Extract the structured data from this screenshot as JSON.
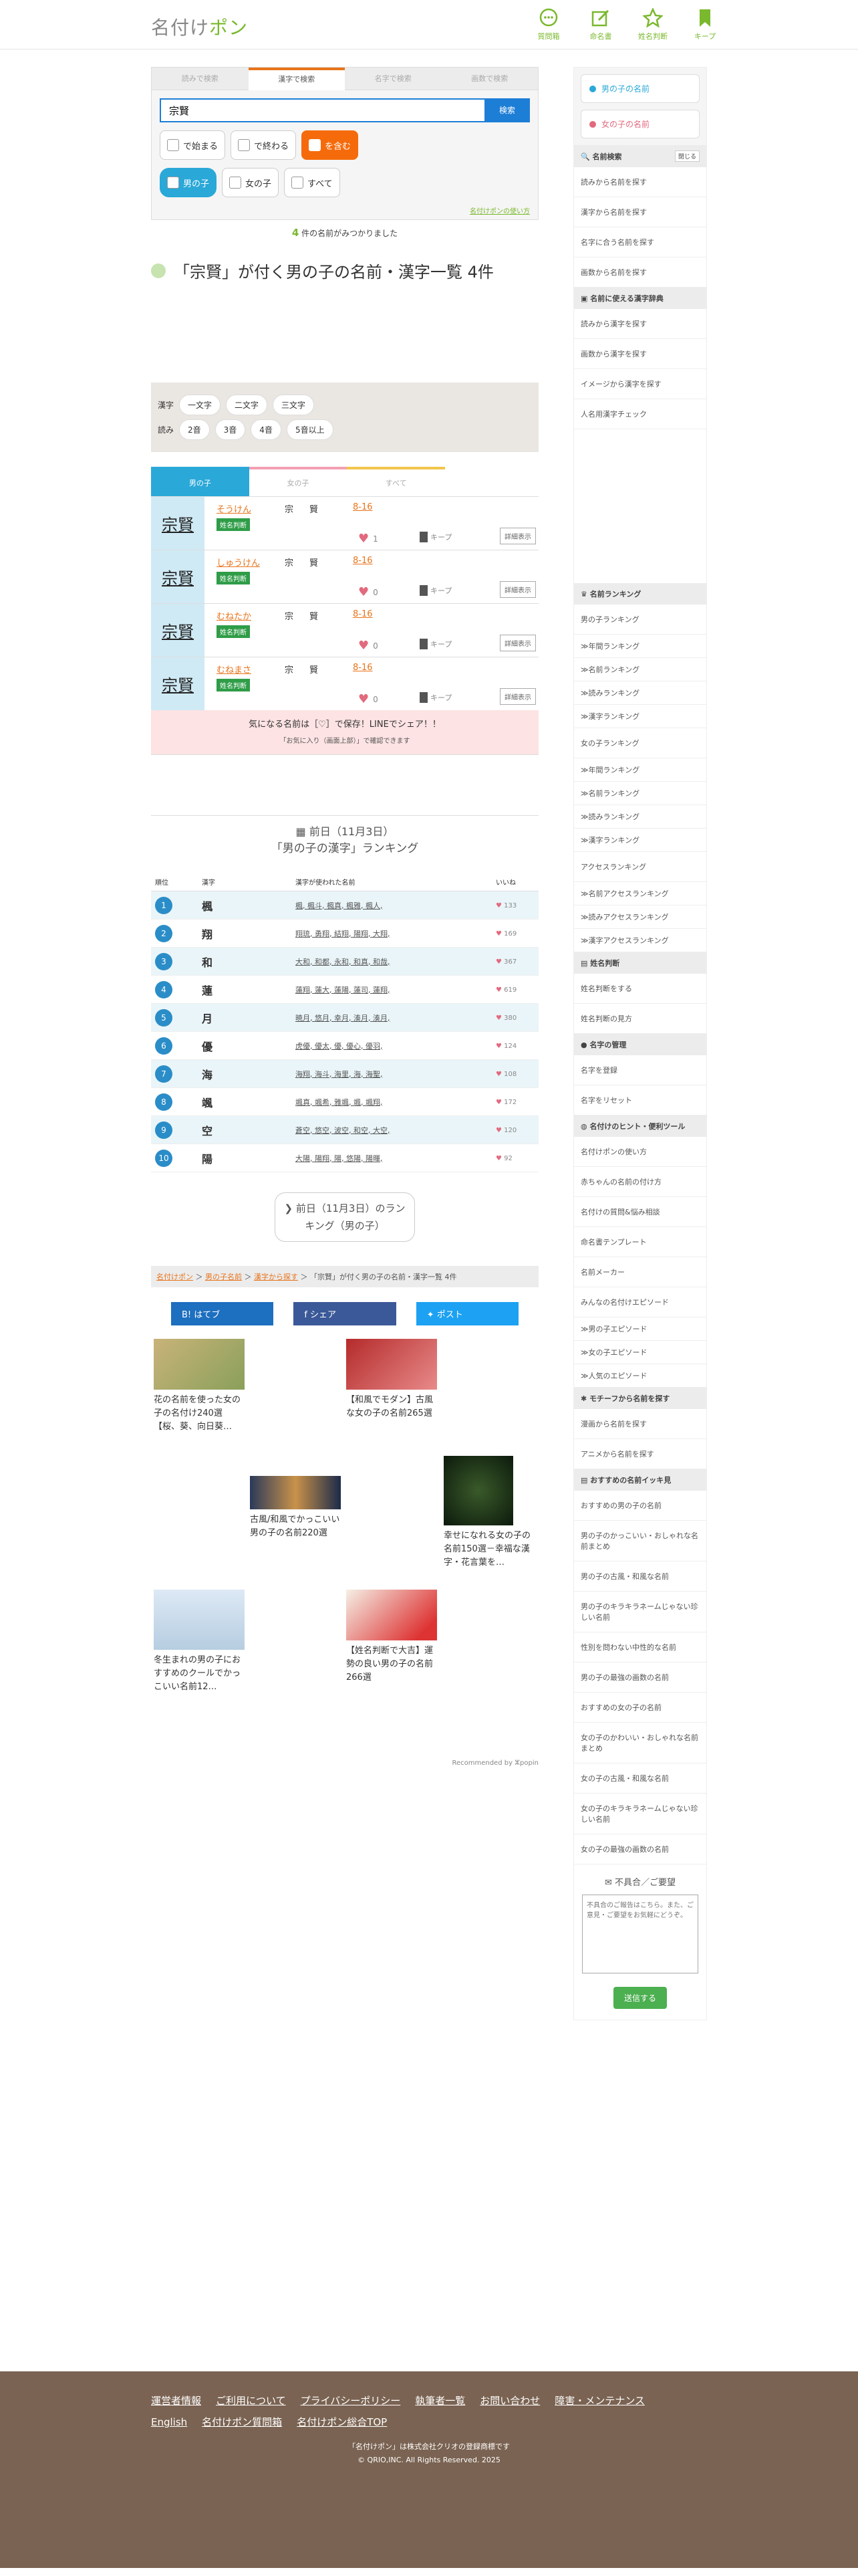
{
  "header": {
    "logo_main": "名付け",
    "logo_accent": "ポン",
    "nav": [
      {
        "label": "質問箱",
        "icon": "chat-icon"
      },
      {
        "label": "命名書",
        "icon": "edit-icon"
      },
      {
        "label": "姓名判断",
        "icon": "star-icon"
      },
      {
        "label": "キープ",
        "icon": "bookmark-icon"
      }
    ]
  },
  "search": {
    "tabs": [
      "読みで検索",
      "漢字で検索",
      "名字で検索",
      "画数で検索"
    ],
    "value": "宗賢",
    "button": "検索",
    "match_opts": [
      "で始まる",
      "で終わる",
      "を含む"
    ],
    "gender_opts": [
      "男の子",
      "女の子",
      "すべて"
    ],
    "help_link": "名付けポンの使い方"
  },
  "result": {
    "count": "4",
    "count_suffix": "件の名前がみつかりました",
    "title": "「宗賢」が付く男の子の名前・漢字一覧 4件"
  },
  "filters": {
    "kanji_label": "漢字",
    "kanji": [
      "一文字",
      "二文字",
      "三文字"
    ],
    "yomi_label": "読み",
    "yomi": [
      "2音",
      "3音",
      "4音",
      "5音以上"
    ]
  },
  "gender_tabs": [
    "男の子",
    "女の子",
    "すべて"
  ],
  "names": [
    {
      "kanji": "宗賢",
      "reading": "そうけん",
      "k1": "宗",
      "k2": "賢",
      "strokes": "8-16",
      "badge": "姓名判断",
      "likes": "1",
      "keep": "キープ",
      "detail": "詳細表示"
    },
    {
      "kanji": "宗賢",
      "reading": "しゅうけん",
      "k1": "宗",
      "k2": "賢",
      "strokes": "8-16",
      "badge": "姓名判断",
      "likes": "0",
      "keep": "キープ",
      "detail": "詳細表示"
    },
    {
      "kanji": "宗賢",
      "reading": "むねたか",
      "k1": "宗",
      "k2": "賢",
      "strokes": "8-16",
      "badge": "姓名判断",
      "likes": "0",
      "keep": "キープ",
      "detail": "詳細表示"
    },
    {
      "kanji": "宗賢",
      "reading": "むねまさ",
      "k1": "宗",
      "k2": "賢",
      "strokes": "8-16",
      "badge": "姓名判断",
      "likes": "0",
      "keep": "キープ",
      "detail": "詳細表示"
    }
  ],
  "save": {
    "text": "気になる名前は［♡］で保存！LINEでシェア！！",
    "sub": "「お気に入り（画面上部）」で確認できます"
  },
  "ranking": {
    "date": "前日（11月3日）",
    "title": "「男の子の漢字」ランキング",
    "cols": [
      "順位",
      "漢字",
      "漢字が使われた名前",
      "いいね"
    ],
    "rows": [
      {
        "n": "1",
        "k": "楓",
        "names": "楓, 楓斗, 楓真, 楓雅, 楓人,",
        "likes": "133"
      },
      {
        "n": "2",
        "k": "翔",
        "names": "翔琉, 勇翔, 結翔, 陽翔, 大翔,",
        "likes": "169"
      },
      {
        "n": "3",
        "k": "和",
        "names": "大和, 和都, 永和, 和真, 和哉,",
        "likes": "367"
      },
      {
        "n": "4",
        "k": "蓮",
        "names": "蓮翔, 蓮大, 蓮陽, 蓮司, 蓮翔,",
        "likes": "619"
      },
      {
        "n": "5",
        "k": "月",
        "names": "暁月, 悠月, 幸月, 湊月, 湊月,",
        "likes": "380"
      },
      {
        "n": "6",
        "k": "優",
        "names": "虎優, 優太, 優, 優心, 優羽,",
        "likes": "124"
      },
      {
        "n": "7",
        "k": "海",
        "names": "海翔, 海斗, 海里, 海, 海聖,",
        "likes": "108"
      },
      {
        "n": "8",
        "k": "颯",
        "names": "颯真, 颯希, 雅颯, 颯, 颯翔,",
        "likes": "172"
      },
      {
        "n": "9",
        "k": "空",
        "names": "蒼空, 悠空, 波空, 和空, 大空,",
        "likes": "120"
      },
      {
        "n": "10",
        "k": "陽",
        "names": "大陽, 陽翔, 陽, 悠陽, 陽暉,",
        "likes": "92"
      }
    ]
  },
  "prev_button": "前日（11月3日）のランキング（男の子）",
  "breadcrumb": [
    "名付けポン",
    "男の子名前",
    "漢字から探す",
    "「宗賢」が付く男の子の名前・漢字一覧 4件"
  ],
  "share": [
    "はてブ",
    "シェア",
    "ポスト"
  ],
  "recs": [
    {
      "title": "花の名前を使った女の子の名付け240選【桜、葵、向日葵…"
    },
    {
      "title": "【和風でモダン】古風な女の子の名前265選"
    },
    {
      "title": "古風/和風でかっこいい男の子の名前220選"
    },
    {
      "title": "幸せになれる女の子の名前150選－幸福な漢字・花言葉を…"
    },
    {
      "title": "冬生まれの男の子におすすめのクールでかっこいい名前12…"
    },
    {
      "title": "【姓名判断で大吉】運勢の良い男の子の名前266選"
    }
  ],
  "rec_by": "Recommended by ⵣpopin",
  "sidebar": {
    "boy": "男の子の名前",
    "girl": "女の子の名前",
    "sec1": {
      "title": "名前検索",
      "close": "閉じる",
      "items": [
        "読みから名前を探す",
        "漢字から名前を探す",
        "名字に合う名前を探す",
        "画数から名前を探す"
      ]
    },
    "sec2": {
      "title": "名前に使える漢字辞典",
      "items": [
        "読みから漢字を探す",
        "画数から漢字を探す",
        "イメージから漢字を探す",
        "人名用漢字チェック"
      ]
    },
    "sec3": {
      "title": "名前ランキング",
      "items": [
        "男の子ランキング",
        "≫年間ランキング",
        "≫名前ランキング",
        "≫読みランキング",
        "≫漢字ランキング",
        "女の子ランキング",
        "≫年間ランキング",
        "≫名前ランキング",
        "≫読みランキング",
        "≫漢字ランキング",
        "アクセスランキング",
        "≫名前アクセスランキング",
        "≫読みアクセスランキング",
        "≫漢字アクセスランキング"
      ]
    },
    "sec4": {
      "title": "姓名判断",
      "items": [
        "姓名判断をする",
        "姓名判断の見方"
      ]
    },
    "sec5": {
      "title": "名字の管理",
      "items": [
        "名字を登録",
        "名字をリセット"
      ]
    },
    "sec6": {
      "title": "名付けのヒント・便利ツール",
      "items": [
        "名付けポンの使い方",
        "赤ちゃんの名前の付け方",
        "名付けの質問&悩み相談",
        "命名書テンプレート",
        "名前メーカー",
        "みんなの名付けエピソード",
        "≫男の子エピソード",
        "≫女の子エピソード",
        "≫人気のエピソード"
      ]
    },
    "sec7": {
      "title": "モチーフから名前を探す",
      "items": [
        "漫画から名前を探す",
        "アニメから名前を探す"
      ]
    },
    "sec8": {
      "title": "おすすめの名前イッキ見",
      "items": [
        "おすすめの男の子の名前",
        "男の子のかっこいい・おしゃれな名前まとめ",
        "男の子の古風・和風な名前",
        "男の子のキラキラネームじゃない珍しい名前",
        "性別を問わない中性的な名前",
        "男の子の最強の画数の名前",
        "おすすめの女の子の名前",
        "女の子のかわいい・おしゃれな名前まとめ",
        "女の子の古風・和風な名前",
        "女の子のキラキラネームじゃない珍しい名前",
        "女の子の最強の画数の名前"
      ]
    },
    "feedback": {
      "title": "不具合／ご要望",
      "placeholder": "不具合のご報告はこちら。また、ご意見・ご要望をお気軽にどうぞ。",
      "submit": "送信する"
    }
  },
  "footer": {
    "links": [
      "運営者情報",
      "ご利用について",
      "プライバシーポリシー",
      "執筆者一覧",
      "お問い合わせ",
      "障害・メンテナンス",
      "English",
      "名付けポン質問箱",
      "名付けポン総合TOP"
    ],
    "note": "「名付けポン」は株式会社クリオの登録商標です",
    "copy": "© QRIO,INC. All Rights Reserved. 2025"
  },
  "colors": {
    "green": "#7ab82d",
    "orange": "#e8741c",
    "blue": "#2aa8d8",
    "footer": "#7a6352"
  }
}
